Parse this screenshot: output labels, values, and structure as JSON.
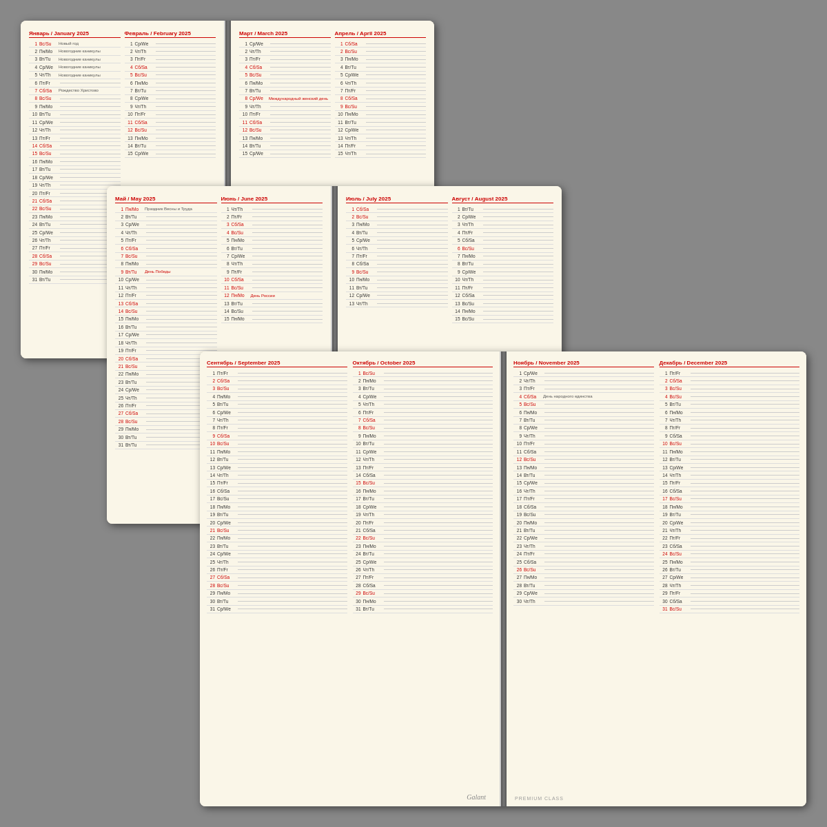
{
  "brand": "Galant",
  "premium": "PREMIUM CLASS",
  "notebooks": [
    {
      "id": "nb1",
      "months": [
        {
          "name": "Январь / January 2025",
          "days": [
            {
              "n": 1,
              "code": "Вс/Su",
              "event": "Новый год",
              "red": true
            },
            {
              "n": 2,
              "code": "Пн/Mo",
              "event": "Новогодние каникулы",
              "red": false
            },
            {
              "n": 3,
              "code": "Вт/Tu",
              "event": "Новогодние каникулы",
              "red": false
            },
            {
              "n": 4,
              "code": "Ср/We",
              "event": "Новогодние каникулы",
              "red": false
            },
            {
              "n": 5,
              "code": "Чт/Th",
              "event": "Новогодние каникулы",
              "red": false
            },
            {
              "n": 6,
              "code": "Пт/Fr",
              "event": "",
              "red": false
            },
            {
              "n": 7,
              "code": "Сб/Sa",
              "event": "Рождество Христово",
              "red": true
            },
            {
              "n": 8,
              "code": "Вс/Su",
              "event": "",
              "red": true
            },
            {
              "n": 9,
              "code": "Пн/Mo",
              "event": "",
              "red": false
            },
            {
              "n": 10,
              "code": "Вт/Tu",
              "event": "",
              "red": false
            },
            {
              "n": 11,
              "code": "Ср/We",
              "event": "",
              "red": false
            },
            {
              "n": 12,
              "code": "Чт/Th",
              "event": "",
              "red": false
            },
            {
              "n": 13,
              "code": "Пт/Fr",
              "event": "",
              "red": false
            },
            {
              "n": 14,
              "code": "Сб/Sa",
              "event": "",
              "red": true
            },
            {
              "n": 15,
              "code": "Вс/Su",
              "event": "",
              "red": true
            },
            {
              "n": 16,
              "code": "Пн/Mo",
              "event": "",
              "red": false
            },
            {
              "n": 17,
              "code": "Вт/Tu",
              "event": "",
              "red": false
            },
            {
              "n": 18,
              "code": "Ср/We",
              "event": "",
              "red": false
            },
            {
              "n": 19,
              "code": "Чт/Th",
              "event": "",
              "red": false
            },
            {
              "n": 20,
              "code": "Пт/Fr",
              "event": "",
              "red": false
            },
            {
              "n": 21,
              "code": "Сб/Sa",
              "event": "",
              "red": true
            },
            {
              "n": 22,
              "code": "Вс/Su",
              "event": "",
              "red": true
            },
            {
              "n": 23,
              "code": "Пн/Mo",
              "event": "",
              "red": false
            },
            {
              "n": 24,
              "code": "Вт/Tu",
              "event": "",
              "red": false
            },
            {
              "n": 25,
              "code": "Ср/We",
              "event": "",
              "red": false
            },
            {
              "n": 26,
              "code": "Чт/Th",
              "event": "",
              "red": false
            },
            {
              "n": 27,
              "code": "Пт/Fr",
              "event": "",
              "red": false
            },
            {
              "n": 28,
              "code": "Сб/Sa",
              "event": "",
              "red": true
            },
            {
              "n": 29,
              "code": "Вс/Su",
              "event": "",
              "red": true
            },
            {
              "n": 30,
              "code": "Пн/Mo",
              "event": "",
              "red": false
            },
            {
              "n": 31,
              "code": "Вт/Tu",
              "event": "",
              "red": false
            }
          ]
        },
        {
          "name": "Февраль / February 2025",
          "days": [
            {
              "n": 1,
              "code": "Ср/We",
              "event": "",
              "red": false
            },
            {
              "n": 2,
              "code": "Чт/Th",
              "event": "",
              "red": false
            },
            {
              "n": 3,
              "code": "Пт/Fr",
              "event": "",
              "red": false
            },
            {
              "n": 4,
              "code": "Сб/Sa",
              "event": "",
              "red": true
            },
            {
              "n": 5,
              "code": "Вс/Su",
              "event": "",
              "red": true
            },
            {
              "n": 6,
              "code": "Пн/Mo",
              "event": "",
              "red": false
            },
            {
              "n": 7,
              "code": "Вт/Tu",
              "event": "",
              "red": false
            },
            {
              "n": 8,
              "code": "Ср/We",
              "event": "",
              "red": false
            },
            {
              "n": 9,
              "code": "Чт/Th",
              "event": "",
              "red": false
            },
            {
              "n": 10,
              "code": "Пт/Fr",
              "event": "",
              "red": false
            },
            {
              "n": 11,
              "code": "Сб/Sa",
              "event": "",
              "red": true
            },
            {
              "n": 12,
              "code": "Вс/Su",
              "event": "",
              "red": true
            },
            {
              "n": 13,
              "code": "Пн/Mo",
              "event": "",
              "red": false
            },
            {
              "n": 14,
              "code": "Вт/Tu",
              "event": "",
              "red": false
            },
            {
              "n": 15,
              "code": "Ср/We",
              "event": "",
              "red": false
            }
          ]
        },
        {
          "name": "Март / March 2025",
          "days": [
            {
              "n": 1,
              "code": "Ср/We",
              "event": "",
              "red": false
            },
            {
              "n": 2,
              "code": "Чт/Th",
              "event": "",
              "red": false
            },
            {
              "n": 3,
              "code": "Пт/Fr",
              "event": "",
              "red": false
            },
            {
              "n": 4,
              "code": "Сб/Sa",
              "event": "",
              "red": true
            },
            {
              "n": 5,
              "code": "Вс/Su",
              "event": "",
              "red": true
            },
            {
              "n": 6,
              "code": "Пн/Mo",
              "event": "",
              "red": false
            },
            {
              "n": 7,
              "code": "Вт/Tu",
              "event": "",
              "red": false
            },
            {
              "n": 8,
              "code": "Ср/We",
              "event": "Международный женский день",
              "red": true
            },
            {
              "n": 9,
              "code": "Чт/Th",
              "event": "",
              "red": false
            },
            {
              "n": 10,
              "code": "Пт/Fr",
              "event": "",
              "red": false
            },
            {
              "n": 11,
              "code": "Сб/Sa",
              "event": "",
              "red": true
            },
            {
              "n": 12,
              "code": "Вс/Su",
              "event": "",
              "red": true
            },
            {
              "n": 13,
              "code": "Пн/Mo",
              "event": "",
              "red": false
            }
          ]
        },
        {
          "name": "Апрель / April 2025",
          "days": [
            {
              "n": 1,
              "code": "Сб/Sa",
              "event": "",
              "red": true
            },
            {
              "n": 2,
              "code": "Вс/Su",
              "event": "",
              "red": true
            },
            {
              "n": 3,
              "code": "Пн/Mo",
              "event": "",
              "red": false
            },
            {
              "n": 4,
              "code": "Вт/Tu",
              "event": "",
              "red": false
            },
            {
              "n": 5,
              "code": "Ср/We",
              "event": "",
              "red": false
            },
            {
              "n": 6,
              "code": "Чт/Th",
              "event": "",
              "red": false
            },
            {
              "n": 7,
              "code": "Пт/Fr",
              "event": "",
              "red": false
            },
            {
              "n": 8,
              "code": "Сб/Sa",
              "event": "",
              "red": true
            },
            {
              "n": 9,
              "code": "Вс/Su",
              "event": "",
              "red": true
            },
            {
              "n": 10,
              "code": "Пн/Mo",
              "event": "",
              "red": false
            },
            {
              "n": 11,
              "code": "Вт/Tu",
              "event": "",
              "red": false
            },
            {
              "n": 12,
              "code": "Ср/We",
              "event": "",
              "red": false
            },
            {
              "n": 13,
              "code": "Чт/Th",
              "event": "",
              "red": false
            },
            {
              "n": 14,
              "code": "Пт/Fr",
              "event": "",
              "red": false
            },
            {
              "n": 15,
              "code": "Чт/Th",
              "event": "",
              "red": false
            }
          ]
        }
      ]
    }
  ]
}
